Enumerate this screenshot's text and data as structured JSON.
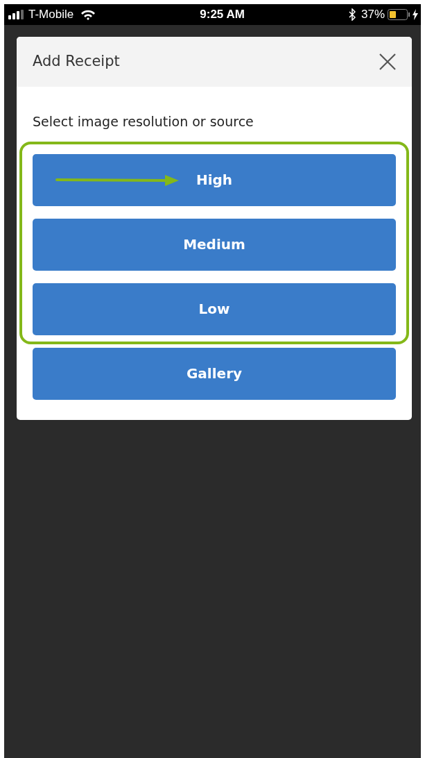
{
  "status_bar": {
    "carrier": "T-Mobile",
    "time": "9:25 AM",
    "battery": "37%"
  },
  "dialog": {
    "title": "Add Receipt",
    "prompt": "Select image resolution or source",
    "options": [
      {
        "label": "High",
        "highlighted": true,
        "arrow": true
      },
      {
        "label": "Medium",
        "highlighted": true,
        "arrow": false
      },
      {
        "label": "Low",
        "highlighted": true,
        "arrow": false
      },
      {
        "label": "Gallery",
        "highlighted": false,
        "arrow": false
      }
    ]
  }
}
